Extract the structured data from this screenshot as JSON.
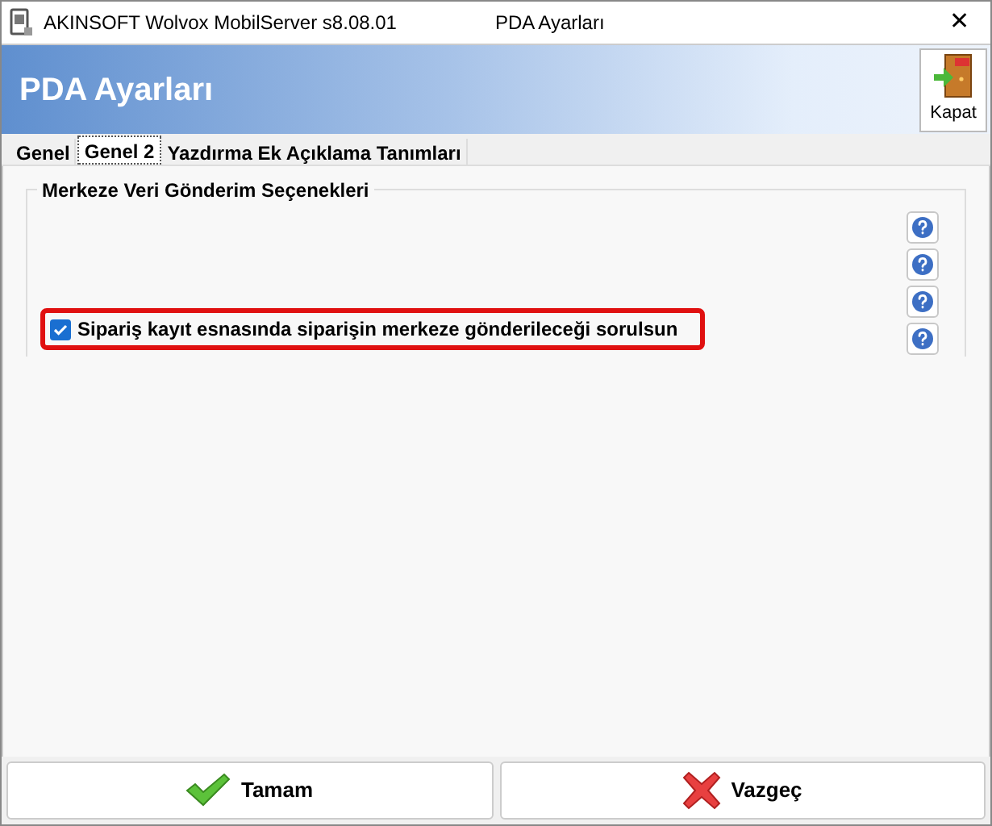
{
  "window": {
    "app_title": "AKINSOFT Wolvox MobilServer s8.08.01",
    "title": "PDA Ayarları",
    "close": "✕"
  },
  "header": {
    "title": "PDA Ayarları",
    "close_button": "Kapat"
  },
  "tabs": [
    {
      "label": "Genel",
      "selected": false
    },
    {
      "label": "Genel 2",
      "selected": true
    },
    {
      "label": "Yazdırma Ek Açıklama Tanımları",
      "selected": false
    }
  ],
  "group": {
    "title": "Merkeze Veri Gönderim Seçenekleri",
    "options": [
      {
        "label": "Sipariş kayıt esnasında siparişin merkeze gönderileceği sorulsun",
        "checked": true,
        "highlighted": true
      }
    ]
  },
  "buttons": [
    {
      "kind": "ok",
      "label": "Tamam"
    },
    {
      "kind": "cancel",
      "label": "Vazgeç"
    }
  ]
}
